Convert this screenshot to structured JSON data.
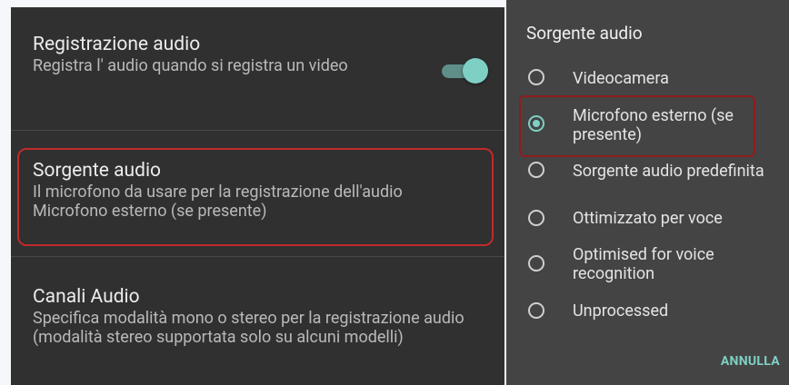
{
  "settings": {
    "record_audio": {
      "title": "Registrazione audio",
      "summary": "Registra l' audio quando si registra un video",
      "toggle_on": true
    },
    "audio_source": {
      "title": "Sorgente audio",
      "summary_line1": "Il microfono da usare per la registrazione dell'audio",
      "summary_line2": "Microfono esterno (se presente)"
    },
    "audio_channels": {
      "title": "Canali Audio",
      "summary": "Specifica modalità mono o stereo per la registrazione audio (modalità stereo supportata solo su alcuni modelli)"
    }
  },
  "dialog": {
    "title": "Sorgente audio",
    "options": [
      {
        "label": "Videocamera",
        "selected": false
      },
      {
        "label": "Microfono esterno (se presente)",
        "selected": true
      },
      {
        "label": "Sorgente audio predefinita",
        "selected": false
      },
      {
        "label": "Ottimizzato per voce",
        "selected": false
      },
      {
        "label": "Optimised for voice recognition",
        "selected": false
      },
      {
        "label": "Unprocessed",
        "selected": false
      }
    ],
    "cancel_label": "ANNULLA"
  },
  "colors": {
    "accent": "#7fd0c4",
    "highlight": "#c12a2a"
  }
}
